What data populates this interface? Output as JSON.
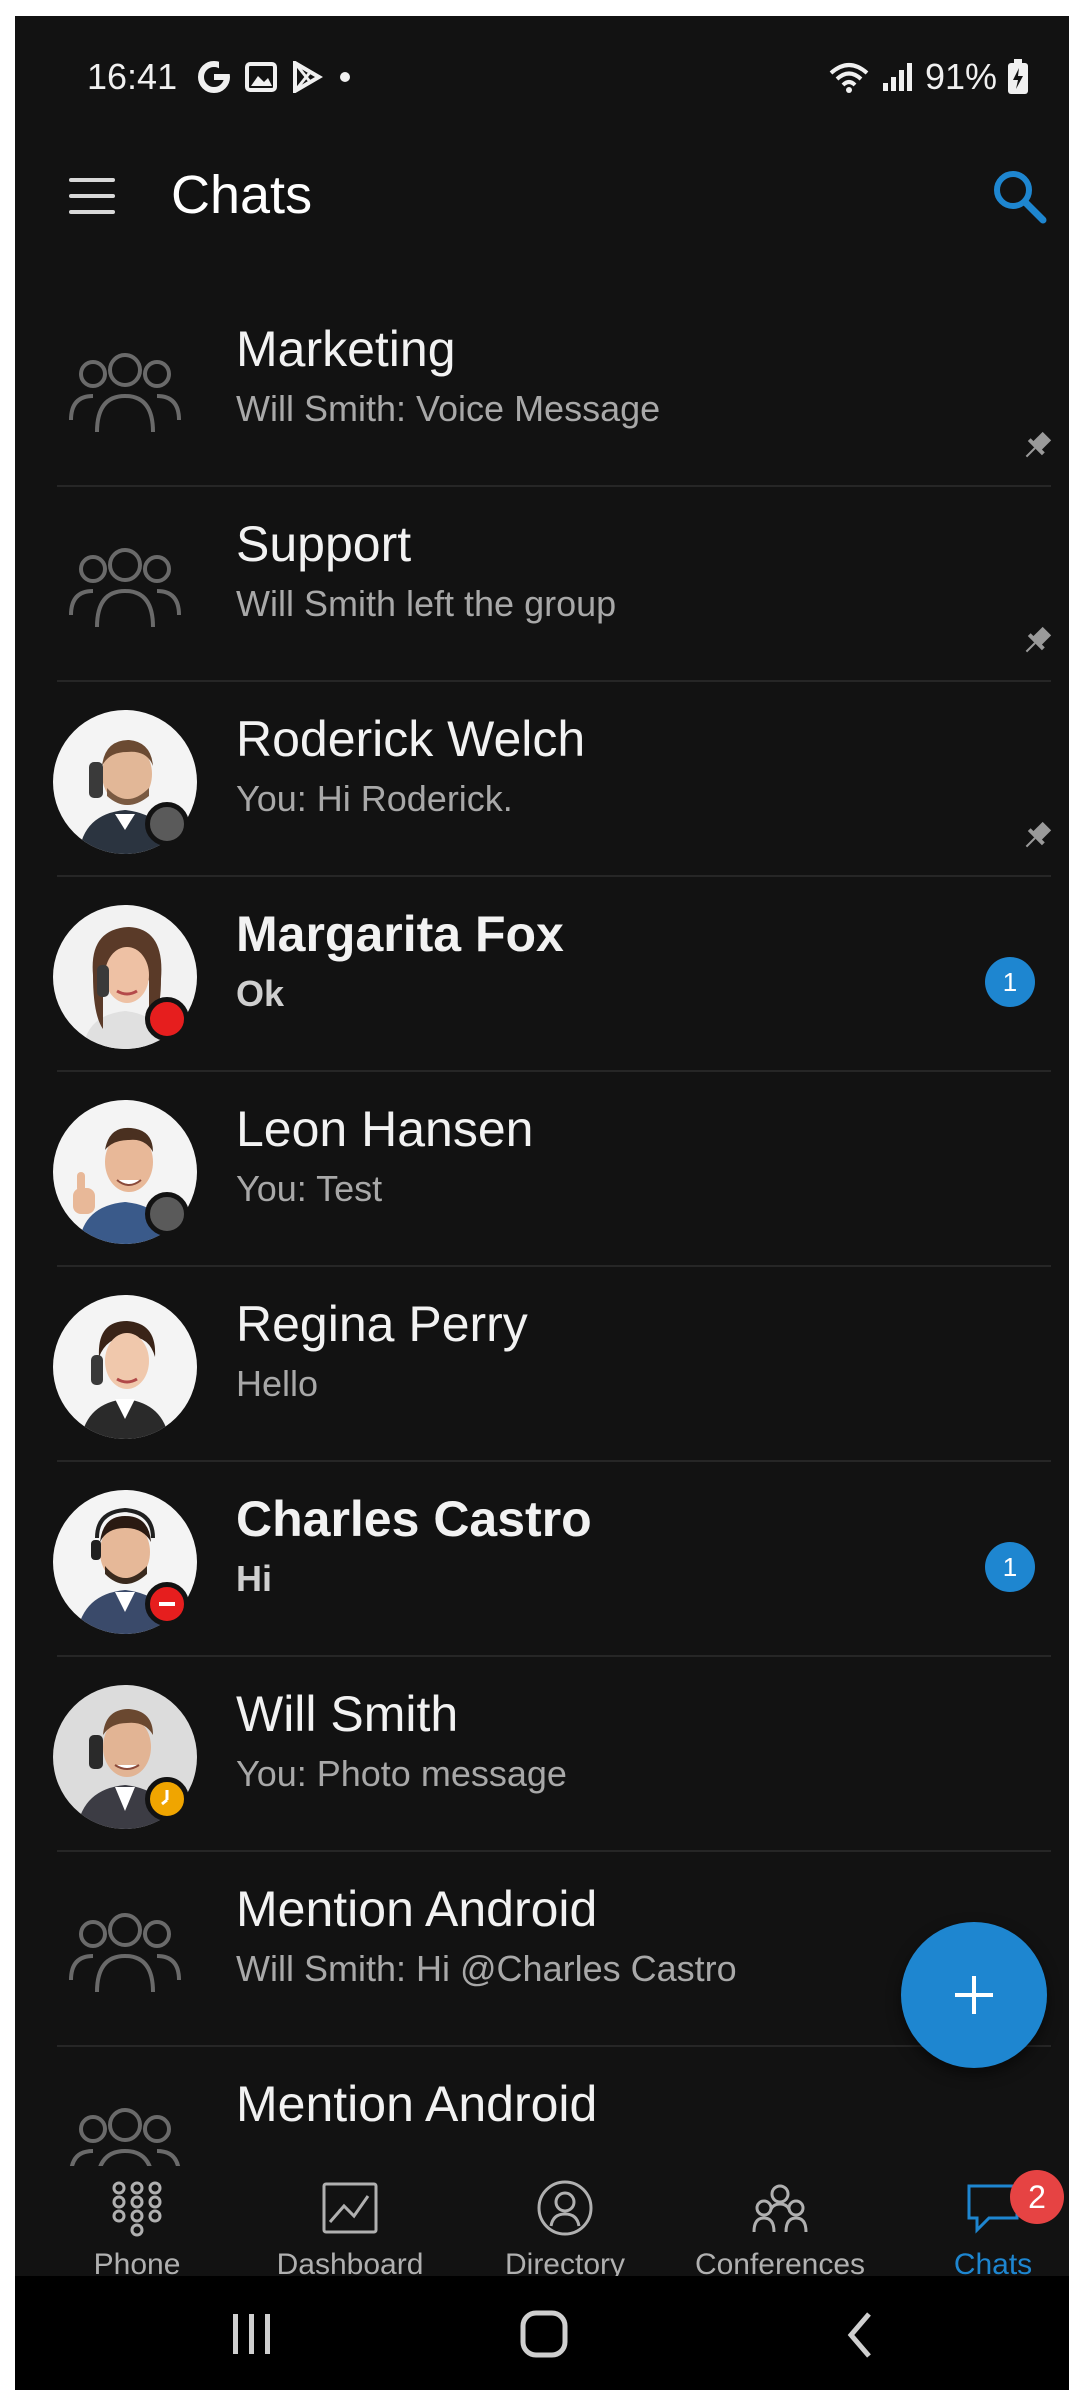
{
  "status_bar": {
    "time": "16:41",
    "battery": "91%"
  },
  "app_bar": {
    "title": "Chats"
  },
  "chats": [
    {
      "name": "Marketing",
      "preview": "Will Smith: Voice Message",
      "type": "group",
      "pinned": true,
      "unread": false
    },
    {
      "name": "Support",
      "preview": "Will Smith left the group",
      "type": "group",
      "pinned": true,
      "unread": false
    },
    {
      "name": "Roderick Welch",
      "preview": "You: Hi Roderick.",
      "type": "person",
      "presence": "offline",
      "pinned": true,
      "unread": false
    },
    {
      "name": "Margarita Fox",
      "preview": "Ok",
      "type": "person",
      "presence": "busy",
      "unread": true,
      "badge": "1"
    },
    {
      "name": "Leon Hansen",
      "preview": "You: Test",
      "type": "person",
      "presence": "offline",
      "unread": false
    },
    {
      "name": "Regina Perry",
      "preview": "Hello",
      "type": "person",
      "unread": false
    },
    {
      "name": "Charles Castro",
      "preview": "Hi",
      "type": "person",
      "presence": "do-not-disturb",
      "unread": true,
      "badge": "1"
    },
    {
      "name": "Will Smith",
      "preview": "You: Photo message",
      "type": "person",
      "presence": "away",
      "unread": false
    },
    {
      "name": "Mention Android",
      "preview": "Will Smith: Hi @Charles Castro",
      "type": "group",
      "unread": false
    },
    {
      "name": "Mention Android",
      "preview": "",
      "type": "group",
      "unread": false
    }
  ],
  "bottom_nav": {
    "items": [
      {
        "label": "Phone",
        "icon": "dialpad-icon"
      },
      {
        "label": "Dashboard",
        "icon": "dashboard-icon"
      },
      {
        "label": "Directory",
        "icon": "directory-icon"
      },
      {
        "label": "Conferences",
        "icon": "conferences-icon"
      },
      {
        "label": "Chats",
        "icon": "chat-icon",
        "active": true,
        "badge": "2"
      }
    ]
  },
  "colors": {
    "accent": "#1e86d0",
    "background": "#121212",
    "busy": "#e61e1e",
    "away": "#f0a500",
    "offline": "#5a5a5a",
    "nav_badge": "#e64343"
  }
}
